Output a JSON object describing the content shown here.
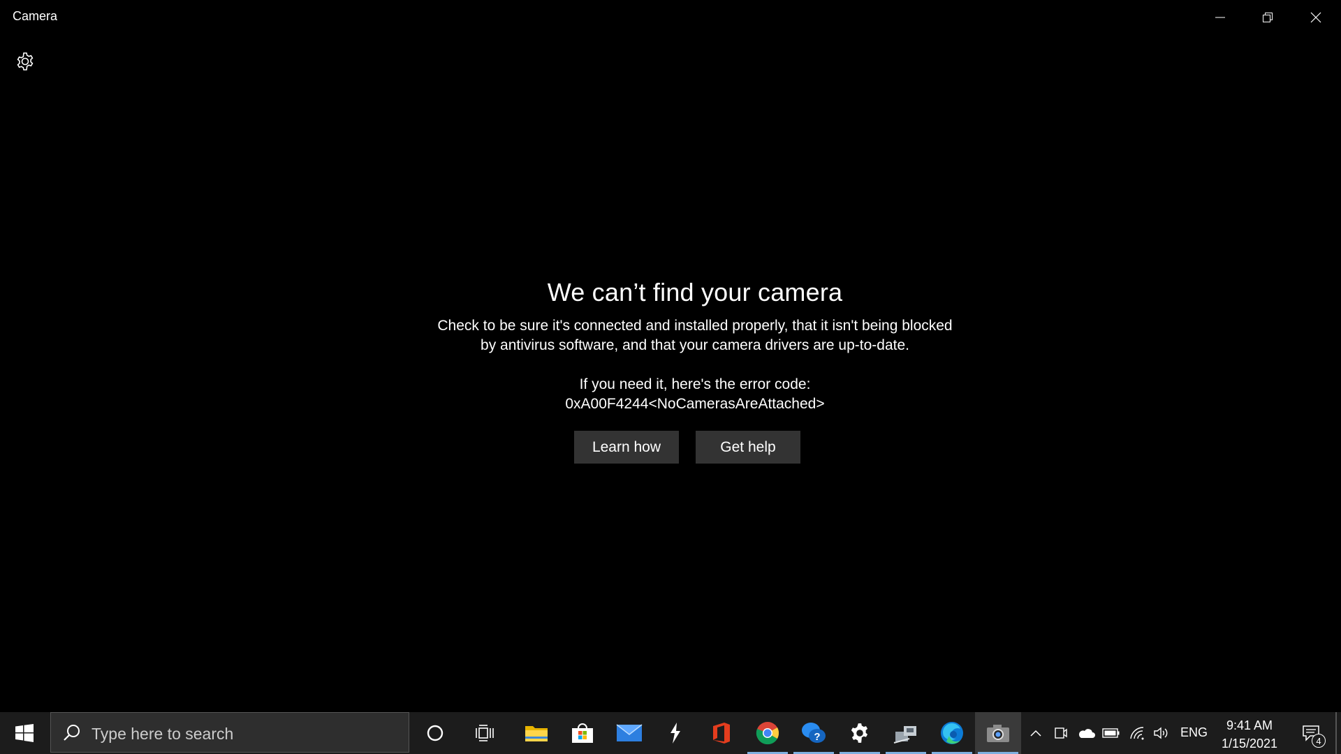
{
  "window": {
    "title": "Camera",
    "controls": [
      "minimize",
      "restore",
      "close"
    ]
  },
  "error": {
    "headline": "We can’t find your camera",
    "description_line1": "Check to be sure it's connected and installed properly, that it isn't being blocked",
    "description_line2": "by antivirus software, and that your camera drivers are up-to-date.",
    "code_label": "If you need it, here's the error code:",
    "code": "0xA00F4244<NoCamerasAreAttached>",
    "learn_button": "Learn how",
    "help_button": "Get help"
  },
  "taskbar": {
    "search_placeholder": "Type here to search",
    "pinned": [
      {
        "name": "cortana-icon"
      },
      {
        "name": "task-view-icon"
      },
      {
        "name": "file-explorer-icon"
      },
      {
        "name": "microsoft-store-icon"
      },
      {
        "name": "mail-icon"
      },
      {
        "name": "app-icon"
      },
      {
        "name": "office-icon"
      },
      {
        "name": "chrome-icon"
      },
      {
        "name": "get-help-icon"
      },
      {
        "name": "settings-icon"
      },
      {
        "name": "network-app-icon"
      },
      {
        "name": "edge-icon"
      },
      {
        "name": "camera-icon"
      }
    ],
    "tray": {
      "language": "ENG",
      "time": "9:41 AM",
      "date": "1/15/2021",
      "notification_count": "4"
    }
  },
  "colors": {
    "background": "#000000",
    "button_bg": "#333333",
    "taskbar_bg": "#1c1c1c",
    "active_indicator": "#7fb0e0"
  }
}
